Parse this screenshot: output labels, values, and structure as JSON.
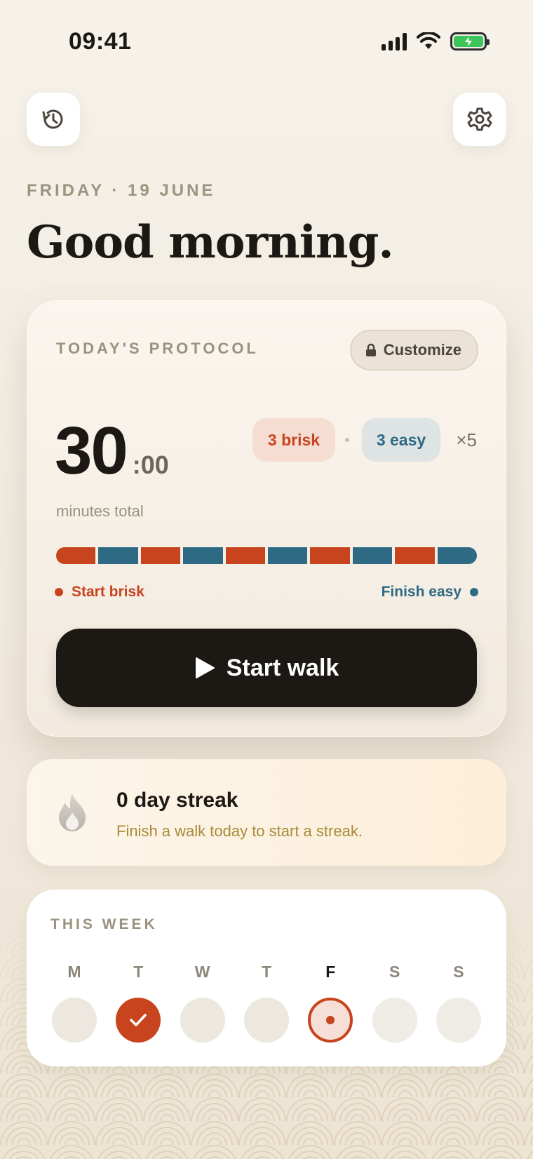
{
  "status_bar": {
    "time": "09:41"
  },
  "header": {
    "date_line": "FRIDAY · 19 JUNE",
    "greeting": "Good morning."
  },
  "protocol": {
    "label": "TODAY'S PROTOCOL",
    "customize_label": "Customize",
    "total_minutes": "30",
    "total_seconds": ":00",
    "minutes_label": "minutes total",
    "brisk_pill": "3 brisk",
    "easy_pill": "3 easy",
    "repeat": "×5",
    "segments": [
      "brisk",
      "easy",
      "brisk",
      "easy",
      "brisk",
      "easy",
      "brisk",
      "easy",
      "brisk",
      "easy"
    ],
    "legend_start": "Start brisk",
    "legend_end": "Finish easy",
    "start_button": "Start walk",
    "colors": {
      "brisk": "#c8441f",
      "easy": "#2f6a84"
    }
  },
  "streak": {
    "title": "0 day streak",
    "subtitle": "Finish a walk today to start a streak."
  },
  "week": {
    "label": "THIS WEEK",
    "days": [
      {
        "letter": "M",
        "state": "missed"
      },
      {
        "letter": "T",
        "state": "done"
      },
      {
        "letter": "W",
        "state": "missed"
      },
      {
        "letter": "T",
        "state": "missed"
      },
      {
        "letter": "F",
        "state": "today"
      },
      {
        "letter": "S",
        "state": "future"
      },
      {
        "letter": "S",
        "state": "future"
      }
    ]
  },
  "icons": {
    "history": "history-icon",
    "settings": "gear-icon",
    "lock": "lock-icon",
    "play": "play-icon",
    "flame": "flame-icon",
    "check": "check-icon"
  }
}
